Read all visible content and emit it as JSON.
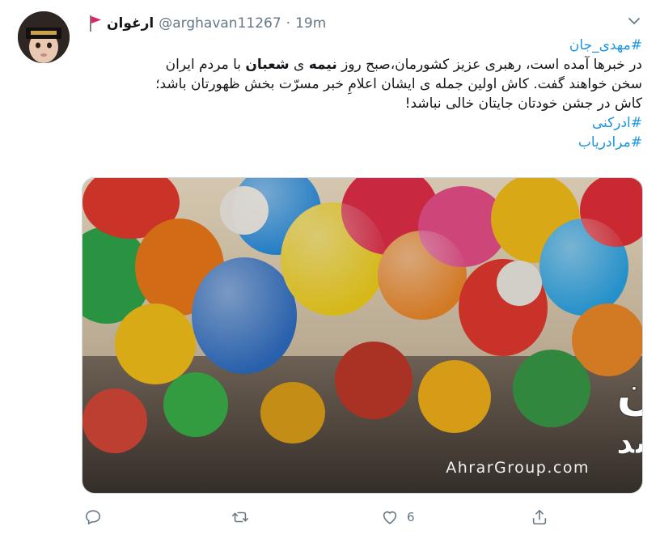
{
  "tweet": {
    "display_name": "ارغوان",
    "handle": "@arghavan11267",
    "separator": "·",
    "time": "19m",
    "lines": {
      "hashtag_top": "#مهدی_جان",
      "l1_a": "در خبرها آمده است، رهبری عزیز کشورمان،صبح روز ",
      "l1_bold1": "نیمه",
      "l1_b": " ی ",
      "l1_bold2": "شعبان",
      "l1_c": " با مردم ایران",
      "l2": "سخن خواهند گفت. کاش اولین جمله ی ایشان اعلامِ خبر مسرّت بخش ظهورتان باشد؛",
      "l3": "کاش در جشن خودتان جایتان خالی نباشد!",
      "hashtag_2": "#ادرکنی",
      "hashtag_3": "#مرادریاب"
    },
    "image": {
      "overlay_line1": "در جشن خودتان",
      "overlay_line2": "کاش جایتان خالی نباشد",
      "watermark": "AhrarGroup.com"
    },
    "actions": {
      "reply_count": "",
      "retweet_count": "",
      "like_count": "6"
    },
    "colors": {
      "link": "#1b95e0",
      "muted": "#657786",
      "flag": "#e0245e"
    },
    "icons": [
      "red-flag-icon",
      "chevron-down-icon",
      "reply-icon",
      "retweet-icon",
      "heart-icon",
      "share-icon"
    ]
  }
}
